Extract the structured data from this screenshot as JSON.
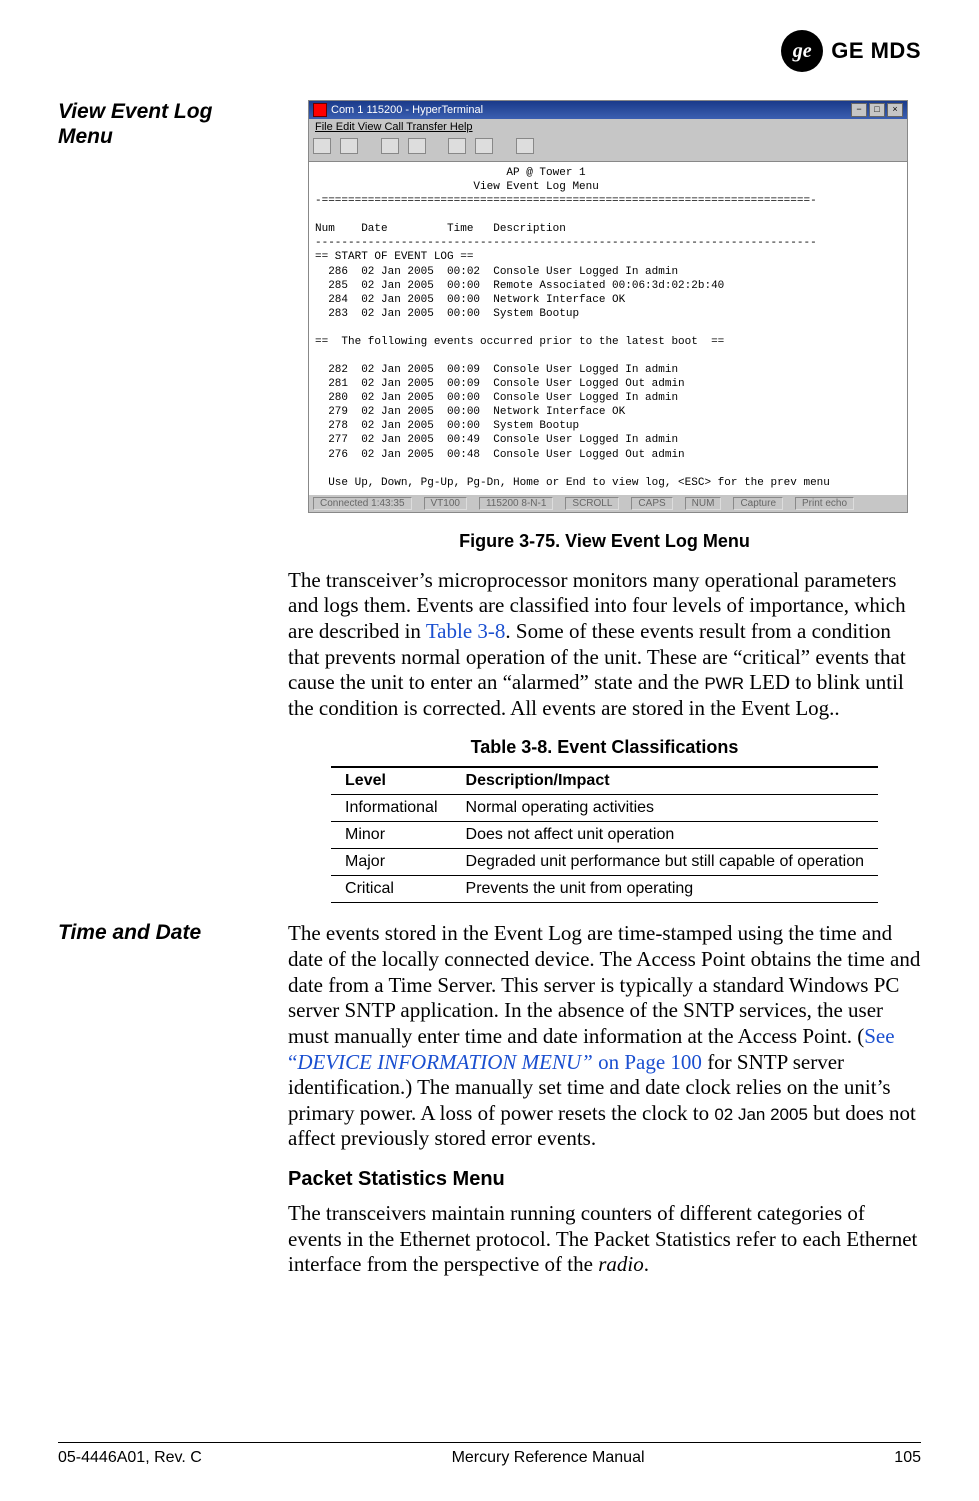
{
  "header": {
    "brand": "GE MDS"
  },
  "margin": {
    "heading1_l1": "View Event Log",
    "heading1_l2": "Menu",
    "heading2": "Time and Date"
  },
  "terminal": {
    "window_title": "Com 1 115200 - HyperTerminal",
    "menubar": "File  Edit  View  Call  Transfer  Help",
    "body": "                             AP @ Tower 1\n                        View Event Log Menu\n-==========================================================================-\n\nNum    Date         Time   Description\n----------------------------------------------------------------------------\n== START OF EVENT LOG ==\n  286  02 Jan 2005  00:02  Console User Logged In admin\n  285  02 Jan 2005  00:00  Remote Associated 00:06:3d:02:2b:40\n  284  02 Jan 2005  00:00  Network Interface OK\n  283  02 Jan 2005  00:00  System Bootup\n\n==  The following events occurred prior to the latest boot  ==\n\n  282  02 Jan 2005  00:09  Console User Logged In admin\n  281  02 Jan 2005  00:09  Console User Logged Out admin\n  280  02 Jan 2005  00:00  Console User Logged In admin\n  279  02 Jan 2005  00:00  Network Interface OK\n  278  02 Jan 2005  00:00  System Bootup\n  277  02 Jan 2005  00:49  Console User Logged In admin\n  276  02 Jan 2005  00:48  Console User Logged Out admin\n\n  Use Up, Down, Pg-Up, Pg-Dn, Home or End to view log, <ESC> for the prev menu",
    "status": [
      "Connected 1:43:35",
      "VT100",
      "115200 8-N-1",
      "SCROLL",
      "CAPS",
      "NUM",
      "Capture",
      "Print echo"
    ]
  },
  "figure": {
    "caption": "Figure 3-75. View Event Log Menu"
  },
  "body": {
    "p1a": "The transceiver’s microprocessor monitors many operational parame­ters and logs them. Events are classified into four levels of importance, which are described in ",
    "p1_link": "Table 3-8",
    "p1b": ". Some of these events result from a condition that prevents normal operation of the unit. These are “critical” events that cause the unit to enter an “alarmed” state and the",
    "pwr": "PWR",
    "p1c": "LED to blink until the condition is corrected. All events are stored in the Event Log..",
    "p2a": "The events stored in the Event Log are time-stamped using the time and date of the locally connected device. The Access Point obtains the time and date from a Time Server. This server is typically a standard Win­dows PC server SNTP application. In the absence of the SNTP services, the user must manually enter time and date information at the Access Point. (",
    "p2_link1": "See “",
    "p2_link2": "DEVICE INFORMATION MENU”",
    "p2_link3": " on Page 100",
    "p2b": " for SNTP server identification.) The manually set time and date clock relies on the unit’s primary power. A loss of power resets the clock to",
    "date": "02 Jan 2005",
    "p2c": "but does not affect previously stored error events.",
    "sect_head": "Packet Statistics Menu",
    "p3a": "The transceivers maintain running counters of different categories of events in the Ethernet protocol. The Packet Statistics refer to each Ethernet interface from the perspective of the ",
    "p3_em": "radio",
    "p3b": "."
  },
  "table": {
    "caption": "Table 3-8. Event Classifications",
    "headers": [
      "Level",
      "Description/Impact"
    ],
    "rows": [
      [
        "Informational",
        "Normal operating activities"
      ],
      [
        "Minor",
        "Does not affect unit operation"
      ],
      [
        "Major",
        "Degraded unit performance but still capable of operation"
      ],
      [
        "Critical",
        "Prevents the unit from operating"
      ]
    ]
  },
  "footer": {
    "left": "05-4446A01, Rev. C",
    "center": "Mercury Reference Manual",
    "right": "105"
  }
}
